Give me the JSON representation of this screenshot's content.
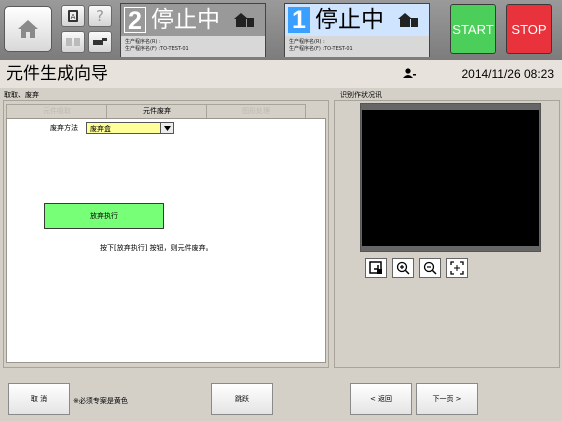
{
  "topbar": {
    "channel2": {
      "number": "2",
      "status": "停止中",
      "line1": "生产程序名(R) :",
      "line2": "生产程序名(F) :TO-TEST-01"
    },
    "channel1": {
      "number": "1",
      "status": "停止中",
      "line1": "生产程序名(R) :",
      "line2": "生产程序名(F) :TO-TEST-01"
    },
    "start_label": "START",
    "stop_label": "STOP"
  },
  "header": {
    "title": "元件生成向导",
    "datetime": "2014/11/26 08:23"
  },
  "left_panel": {
    "group_label": "取取、废弃",
    "tabs": [
      {
        "label": "元件吸取"
      },
      {
        "label": "元件废弃"
      },
      {
        "label": "图形处理"
      }
    ],
    "discard_method_label": "废弃方法",
    "discard_method_value": "废弃盒",
    "exec_button_label": "放弃执行",
    "hint_text": "按下[放弃执行] 按钮，则元件废弃。"
  },
  "right_panel": {
    "group_label": "识别作状况讯"
  },
  "bottom": {
    "cancel_label": "取 消",
    "required_note": "※必须专案是黄色",
    "skip_label": "跳跃",
    "back_label": "< 返回",
    "next_label": "下一页 >"
  },
  "colors": {
    "start": "#4ccf5a",
    "stop": "#e8323c",
    "channel_active": "#3aa0ff",
    "exec_button": "#77ff77",
    "required_field": "#ffff99"
  }
}
